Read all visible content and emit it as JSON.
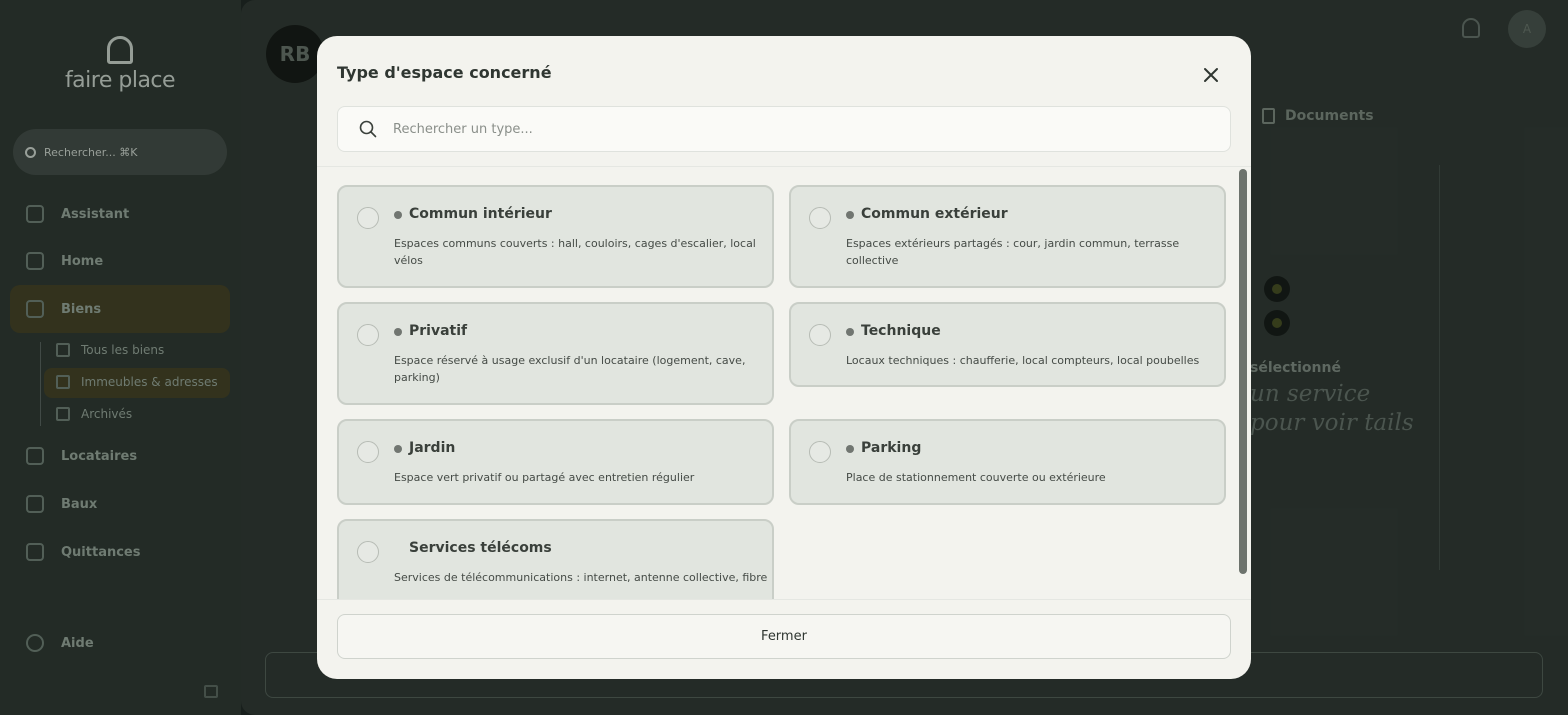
{
  "app": {
    "logo_text": "faire place",
    "search_label": "Rechercher... ⌘K",
    "user_initial": "A"
  },
  "sidebar": {
    "items": [
      {
        "label": "Assistant",
        "icon": "sparkle-icon"
      },
      {
        "label": "Home",
        "icon": "home-icon"
      },
      {
        "label": "Biens",
        "icon": "building-icon"
      },
      {
        "label": "Locataires",
        "icon": "user-icon"
      },
      {
        "label": "Baux",
        "icon": "document-icon"
      },
      {
        "label": "Quittances",
        "icon": "receipt-icon"
      },
      {
        "label": "Aide",
        "icon": "help-icon"
      }
    ],
    "sub_items": [
      {
        "label": "Tous les biens",
        "icon": "building-icon"
      },
      {
        "label": "Immeubles & adresses",
        "icon": "building-icon"
      },
      {
        "label": "Archivés",
        "icon": "archive-icon"
      }
    ]
  },
  "main": {
    "avatar_initials": "RB",
    "tab_documents": "Documents",
    "empty_title": "sélectionné",
    "empty_script": "un service pour voir tails"
  },
  "modal": {
    "title": "Type d'espace concerné",
    "search_placeholder": "Rechercher un type...",
    "close_label": "Fermer",
    "options": [
      {
        "title": "Commun intérieur",
        "description": "Espaces communs couverts : hall, couloirs, cages d'escalier, local vélos",
        "has_dot": true
      },
      {
        "title": "Commun extérieur",
        "description": "Espaces extérieurs partagés : cour, jardin commun, terrasse collective",
        "has_dot": true
      },
      {
        "title": "Privatif",
        "description": "Espace réservé à usage exclusif d'un locataire (logement, cave, parking)",
        "has_dot": true
      },
      {
        "title": "Technique",
        "description": "Locaux techniques : chaufferie, local compteurs, local poubelles",
        "has_dot": true
      },
      {
        "title": "Jardin",
        "description": "Espace vert privatif ou partagé avec entretien régulier",
        "has_dot": true
      },
      {
        "title": "Parking",
        "description": "Place de stationnement couverte ou extérieure",
        "has_dot": true
      },
      {
        "title": "Services télécoms",
        "description": "Services de télécommunications : internet, antenne collective, fibre",
        "has_dot": false
      }
    ]
  },
  "colors": {
    "card_bg": "#e1e5df",
    "card_border": "#c9cec7",
    "modal_bg": "#f3f3ee",
    "sidebar_bg": "#28312c",
    "accent_dark": "#3b3a21"
  }
}
